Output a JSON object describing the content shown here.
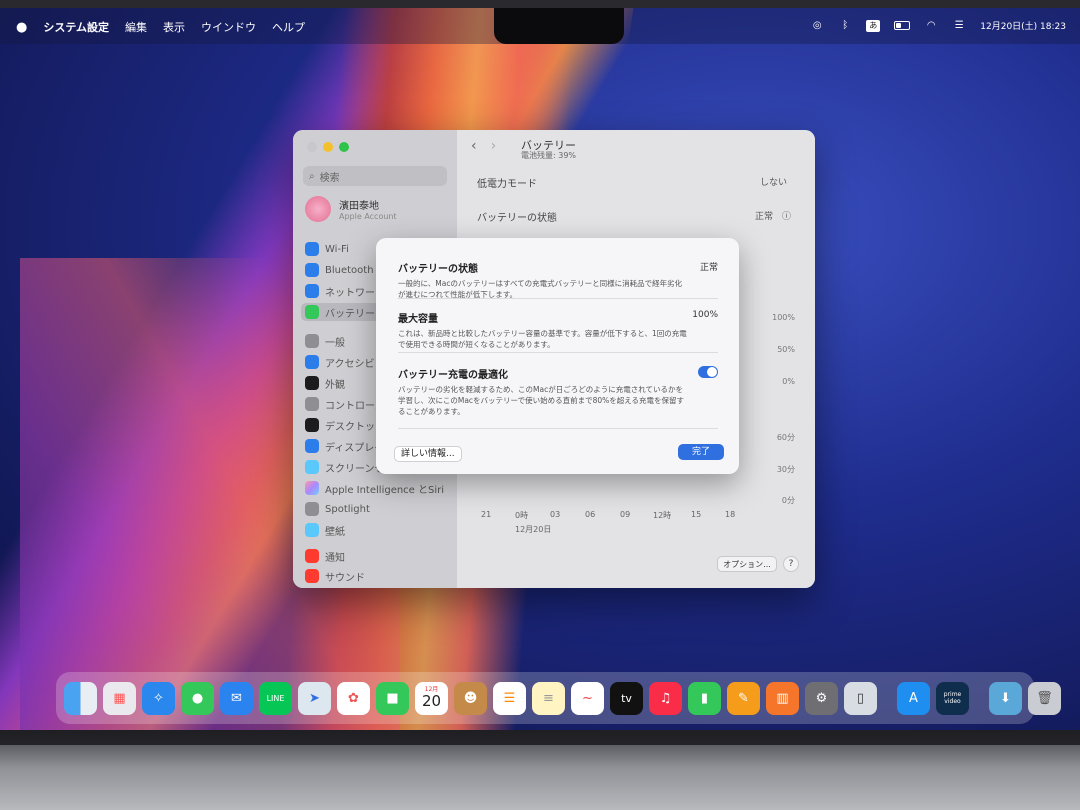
{
  "menubar": {
    "app_name": "システム設定",
    "menus": [
      "編集",
      "表示",
      "ウインドウ",
      "ヘルプ"
    ],
    "ime_indicator": "あ",
    "datetime": "12月20日(土)  18:23"
  },
  "settings_window": {
    "search_placeholder": "検索",
    "account": {
      "name": "濱田泰地",
      "subtitle": "Apple Account"
    },
    "sidebar_items": [
      "Wi-Fi",
      "Bluetooth",
      "ネットワーク",
      "バッテリー",
      "一般",
      "アクセシビリティ",
      "外観",
      "コントロールセンター",
      "デスクトップとDock",
      "ディスプレイ",
      "スクリーンセーバ",
      "Apple Intelligence とSiri",
      "Spotlight",
      "壁紙",
      "通知",
      "サウンド"
    ],
    "title": "バッテリー",
    "subtitle": "電池残量: 39%",
    "low_power_label": "低電力モード",
    "low_power_value": "しない",
    "battery_health_label": "バッテリーの状態",
    "battery_health_value": "正常",
    "chart_y_labels": [
      "100%",
      "50%",
      "0%",
      "60分",
      "30分",
      "0分"
    ],
    "chart_x_labels": [
      "21",
      "0時",
      "03",
      "06",
      "09",
      "12時",
      "15",
      "18"
    ],
    "chart_date": "12月20日",
    "options_button": "オプション...",
    "help_button": "?"
  },
  "sheet": {
    "health_title": "バッテリーの状態",
    "health_value": "正常",
    "health_desc": "一般的に、Macのバッテリーはすべての充電式バッテリーと同様に消耗品で経年劣化が進むにつれて性能が低下します。",
    "capacity_title": "最大容量",
    "capacity_value": "100%",
    "capacity_desc": "これは、新品時と比較したバッテリー容量の基準です。容量が低下すると、1回の充電で使用できる時間が短くなることがあります。",
    "optimize_title": "バッテリー充電の最適化",
    "optimize_desc": "バッテリーの劣化を軽減するため、このMacが日ごろどのように充電されているかを学習し、次にこのMacをバッテリーで使い始める直前まで80%を超える充電を保留することがあります。",
    "optimize_enabled": true,
    "more_info_button": "詳しい情報...",
    "done_button": "完了"
  },
  "dock": {
    "calendar_month": "12月",
    "calendar_day": "20",
    "tv_label": "tv",
    "prime_label": "prime video"
  },
  "colors": {
    "accent": "#2f6fe0"
  }
}
